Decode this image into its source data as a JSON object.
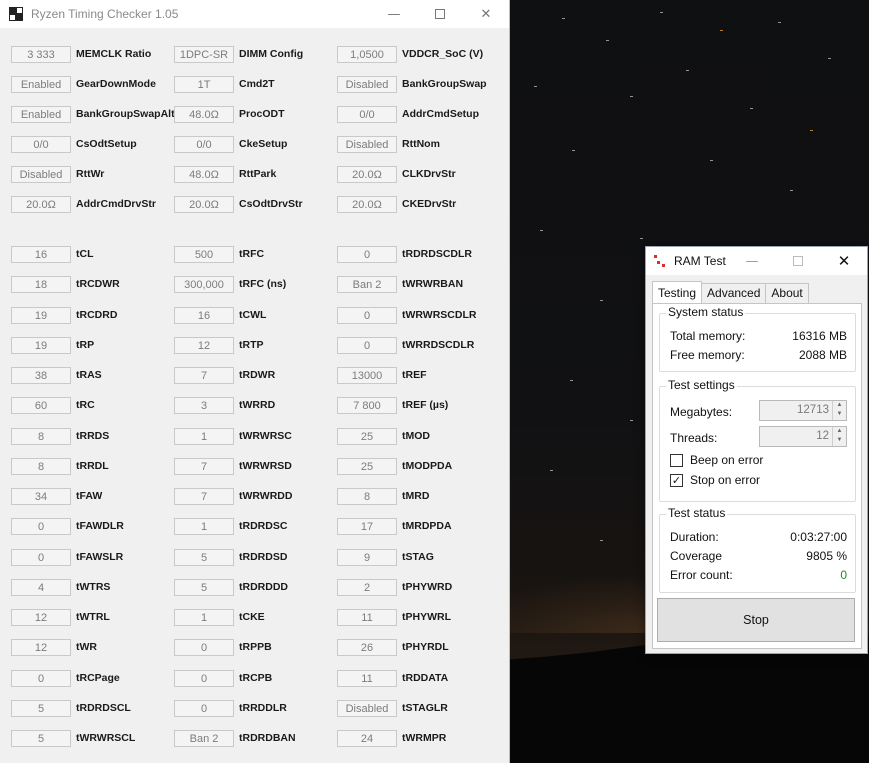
{
  "main_window": {
    "title": "Ryzen Timing Checker 1.05",
    "controls": {
      "minimize": "—",
      "maximize": "",
      "close": "✕"
    },
    "columns": [
      [
        {
          "value": "3 333",
          "label": "MEMCLK Ratio"
        },
        {
          "value": "Enabled",
          "label": "GearDownMode"
        },
        {
          "value": "Enabled",
          "label": "BankGroupSwapAlt"
        },
        {
          "value": "0/0",
          "label": "CsOdtSetup"
        },
        {
          "value": "Disabled",
          "label": "RttWr"
        },
        {
          "value": "20.0Ω",
          "label": "AddrCmdDrvStr"
        },
        {
          "value": "16",
          "label": "tCL"
        },
        {
          "value": "18",
          "label": "tRCDWR"
        },
        {
          "value": "19",
          "label": "tRCDRD"
        },
        {
          "value": "19",
          "label": "tRP"
        },
        {
          "value": "38",
          "label": "tRAS"
        },
        {
          "value": "60",
          "label": "tRC"
        },
        {
          "value": "8",
          "label": "tRRDS"
        },
        {
          "value": "8",
          "label": "tRRDL"
        },
        {
          "value": "34",
          "label": "tFAW"
        },
        {
          "value": "0",
          "label": "tFAWDLR"
        },
        {
          "value": "0",
          "label": "tFAWSLR"
        },
        {
          "value": "4",
          "label": "tWTRS"
        },
        {
          "value": "12",
          "label": "tWTRL"
        },
        {
          "value": "12",
          "label": "tWR"
        },
        {
          "value": "0",
          "label": "tRCPage"
        },
        {
          "value": "5",
          "label": "tRDRDSCL"
        },
        {
          "value": "5",
          "label": "tWRWRSCL"
        }
      ],
      [
        {
          "value": "1DPC-SR",
          "label": "DIMM Config"
        },
        {
          "value": "1T",
          "label": "Cmd2T"
        },
        {
          "value": "48.0Ω",
          "label": "ProcODT"
        },
        {
          "value": "0/0",
          "label": "CkeSetup"
        },
        {
          "value": "48.0Ω",
          "label": "RttPark"
        },
        {
          "value": "20.0Ω",
          "label": "CsOdtDrvStr"
        },
        {
          "value": "500",
          "label": "tRFC"
        },
        {
          "value": "300,000",
          "label": "tRFC (ns)"
        },
        {
          "value": "16",
          "label": "tCWL"
        },
        {
          "value": "12",
          "label": "tRTP"
        },
        {
          "value": "7",
          "label": "tRDWR"
        },
        {
          "value": "3",
          "label": "tWRRD"
        },
        {
          "value": "1",
          "label": "tWRWRSC"
        },
        {
          "value": "7",
          "label": "tWRWRSD"
        },
        {
          "value": "7",
          "label": "tWRWRDD"
        },
        {
          "value": "1",
          "label": "tRDRDSC"
        },
        {
          "value": "5",
          "label": "tRDRDSD"
        },
        {
          "value": "5",
          "label": "tRDRDDD"
        },
        {
          "value": "1",
          "label": "tCKE"
        },
        {
          "value": "0",
          "label": "tRPPB"
        },
        {
          "value": "0",
          "label": "tRCPB"
        },
        {
          "value": "0",
          "label": "tRRDDLR"
        },
        {
          "value": "Ban 2",
          "label": "tRDRDBAN"
        }
      ],
      [
        {
          "value": "1,0500",
          "label": "VDDCR_SoC (V)"
        },
        {
          "value": "Disabled",
          "label": "BankGroupSwap"
        },
        {
          "value": "0/0",
          "label": "AddrCmdSetup"
        },
        {
          "value": "Disabled",
          "label": "RttNom"
        },
        {
          "value": "20.0Ω",
          "label": "CLKDrvStr"
        },
        {
          "value": "20.0Ω",
          "label": "CKEDrvStr"
        },
        {
          "value": "0",
          "label": "tRDRDSCDLR"
        },
        {
          "value": "Ban 2",
          "label": "tWRWRBAN"
        },
        {
          "value": "0",
          "label": "tWRWRSCDLR"
        },
        {
          "value": "0",
          "label": "tWRRDSCDLR"
        },
        {
          "value": "13000",
          "label": "tREF"
        },
        {
          "value": "7 800",
          "label": "tREF (µs)"
        },
        {
          "value": "25",
          "label": "tMOD"
        },
        {
          "value": "25",
          "label": "tMODPDA"
        },
        {
          "value": "8",
          "label": "tMRD"
        },
        {
          "value": "17",
          "label": "tMRDPDA"
        },
        {
          "value": "9",
          "label": "tSTAG"
        },
        {
          "value": "2",
          "label": "tPHYWRD"
        },
        {
          "value": "11",
          "label": "tPHYWRL"
        },
        {
          "value": "26",
          "label": "tPHYRDL"
        },
        {
          "value": "11",
          "label": "tRDDATA"
        },
        {
          "value": "Disabled",
          "label": "tSTAGLR"
        },
        {
          "value": "24",
          "label": "tWRMPR"
        }
      ]
    ]
  },
  "ram_test": {
    "title": "RAM Test",
    "tabs": [
      {
        "label": "Testing",
        "active": true
      },
      {
        "label": "Advanced",
        "active": false
      },
      {
        "label": "About",
        "active": false
      }
    ],
    "system_status": {
      "title": "System status",
      "total_memory_label": "Total memory:",
      "total_memory_value": "16316 MB",
      "free_memory_label": "Free memory:",
      "free_memory_value": "2088 MB"
    },
    "test_settings": {
      "title": "Test settings",
      "megabytes_label": "Megabytes:",
      "megabytes_value": "12713",
      "threads_label": "Threads:",
      "threads_value": "12",
      "beep_label": "Beep on error",
      "beep_checked": false,
      "stop_label": "Stop on error",
      "stop_checked": true,
      "check_mark": "✓"
    },
    "test_status": {
      "title": "Test status",
      "duration_label": "Duration:",
      "duration_value": "0:03:27:00",
      "coverage_label": "Coverage",
      "coverage_value": "9805 %",
      "error_count_label": "Error count:",
      "error_count_value": "0"
    },
    "stop_button": "Stop"
  }
}
